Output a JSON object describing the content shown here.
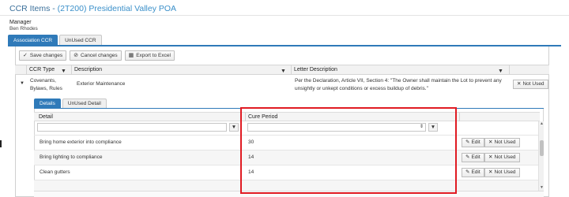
{
  "header": {
    "title_prefix": "CCR Items - ",
    "title_code": "(2T200) Presidential Valley POA"
  },
  "manager": {
    "label": "Manager",
    "name": "Ben Rhodes"
  },
  "tabs": [
    {
      "label": "Association CCR",
      "active": true
    },
    {
      "label": "UnUsed CCR",
      "active": false
    }
  ],
  "toolbar": {
    "save_label": "Save changes",
    "cancel_label": "Cancel changes",
    "export_label": "Export to Excel"
  },
  "ccr_grid": {
    "columns": [
      "CCR Type",
      "Description",
      "Letter Description"
    ],
    "rows": [
      {
        "ccr_type": "Covenants, Bylaws, Rules",
        "description": "Exterior Maintenance",
        "letter_description": "Per the Declaration, Article VII, Section 4: \"The Owner shall maintain the Lot to prevent any unsightly or unkept conditions or excess buildup of debris.\"",
        "action_label": "Not Used"
      }
    ]
  },
  "sub_tabs": [
    {
      "label": "Details",
      "active": true
    },
    {
      "label": "UnUsed Detail",
      "active": false
    }
  ],
  "detail_grid": {
    "columns": [
      "Detail",
      "Cure Period"
    ],
    "rows": [
      {
        "detail": "Bring home exterior into compliance",
        "cure_period": "30",
        "edit_label": "Edit",
        "not_used_label": "Not Used"
      },
      {
        "detail": "Bring lighting to compliance",
        "cure_period": "14",
        "edit_label": "Edit",
        "not_used_label": "Not Used"
      },
      {
        "detail": "Clean gutters",
        "cure_period": "14",
        "edit_label": "Edit",
        "not_used_label": "Not Used"
      }
    ]
  },
  "colors": {
    "accent": "#2f7ab9",
    "title": "#3a6f9a",
    "highlight": "#e01b23"
  },
  "icons": [
    "save-icon",
    "cancel-icon",
    "export-icon",
    "filter-icon",
    "expand-icon",
    "close-icon",
    "edit-icon",
    "spinner-icon"
  ]
}
